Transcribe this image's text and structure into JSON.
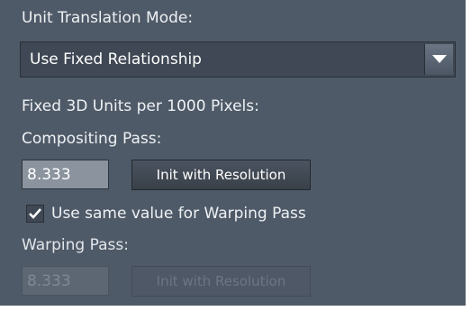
{
  "unit_translation": {
    "label": "Unit Translation Mode:",
    "selected": "Use Fixed Relationship"
  },
  "fixed_units_label": "Fixed 3D Units per 1000 Pixels:",
  "compositing": {
    "label": "Compositing Pass:",
    "value": "8.333",
    "button_label": "Init with Resolution"
  },
  "same_value_checkbox": {
    "label": "Use same value for Warping Pass",
    "checked": true
  },
  "warping": {
    "label": "Warping Pass:",
    "value": "8.333",
    "button_label": "Init with Resolution"
  },
  "colors": {
    "panel_bg": "#4f5a68",
    "field_bg": "#8a939e",
    "dropdown_bg": "#3f4854"
  },
  "icons": {
    "dropdown": "chevron-down-icon",
    "checkbox": "checkmark-icon"
  }
}
